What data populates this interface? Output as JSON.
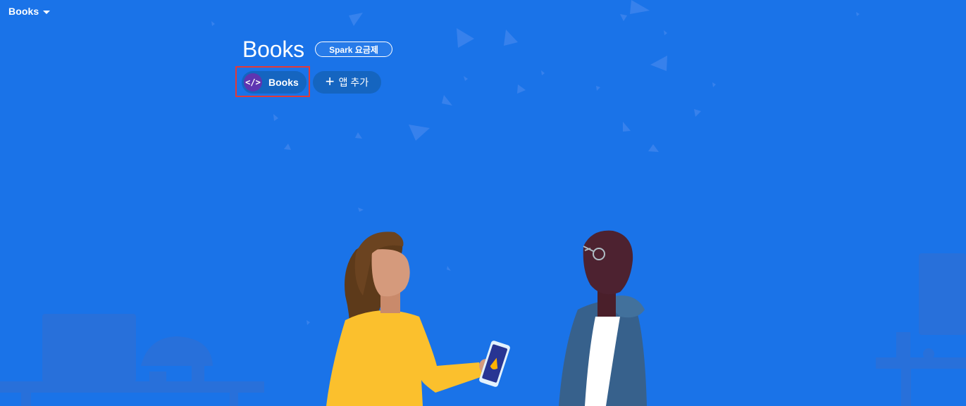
{
  "project_selector": {
    "label": "Books"
  },
  "project": {
    "title": "Books",
    "plan_badge": "Spark 요금제"
  },
  "apps": [
    {
      "label": "Books",
      "icon": "code-icon",
      "icon_glyph": "</>"
    }
  ],
  "add_app": {
    "label": "앱 추가",
    "icon": "plus-icon"
  },
  "colors": {
    "background": "#1a73e8",
    "chip": "#1565c0",
    "app_icon": "#5e35b1",
    "highlight": "#e53935"
  }
}
